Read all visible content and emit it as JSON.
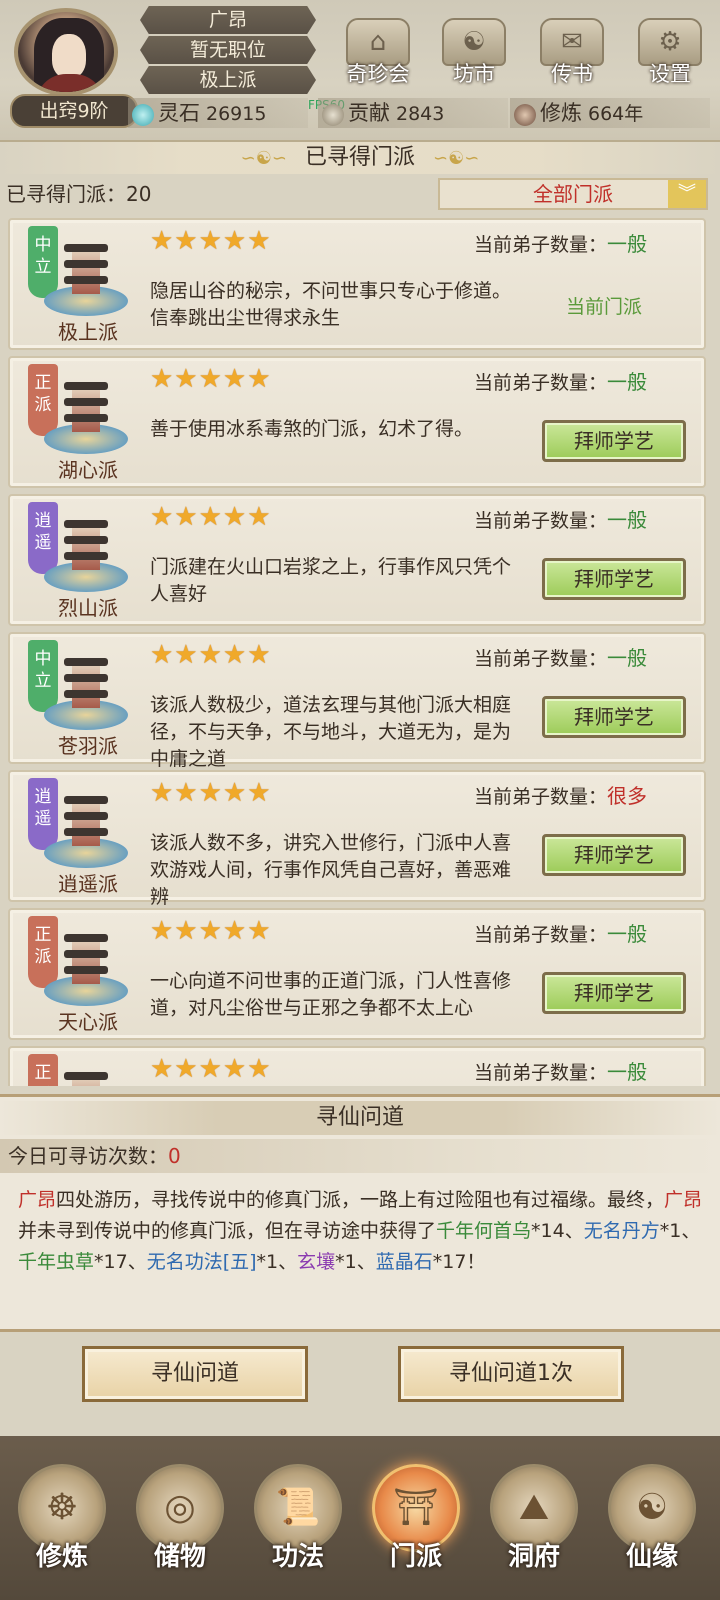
{
  "header": {
    "player_name": "广昂",
    "position": "暂无职位",
    "sect": "极上派",
    "realm": "出窍9阶",
    "resources": [
      {
        "label": "灵石",
        "value": "26915"
      },
      {
        "label": "贡献",
        "value": "2843"
      },
      {
        "label": "修炼",
        "value": "664年"
      }
    ],
    "menu": [
      {
        "label": "奇珍会",
        "icon": "treasure-pavilion-icon"
      },
      {
        "label": "坊市",
        "icon": "market-icon"
      },
      {
        "label": "传书",
        "icon": "scroll-letter-icon"
      },
      {
        "label": "设置",
        "icon": "gear-icon"
      }
    ],
    "fps": "FPS60"
  },
  "sect_list": {
    "title": "已寻得门派",
    "found_label": "已寻得门派：",
    "found_count": "20",
    "filter_value": "全部门派",
    "disciples_label": "当前弟子数量：",
    "items": [
      {
        "tag": [
          "中",
          "立"
        ],
        "tag_color": "#4fae6a",
        "name": "极上派",
        "stars": "★★★★★",
        "disciples": "一般",
        "disciples_color": "#3a8a3a",
        "desc": "隐居山谷的秘宗，不问世事只专心于修道。信奉跳出尘世得求永生",
        "action": "当前门派",
        "is_current": true
      },
      {
        "tag": [
          "正",
          "派"
        ],
        "tag_color": "#c8705a",
        "name": "湖心派",
        "stars": "★★★★★",
        "disciples": "一般",
        "disciples_color": "#3a8a3a",
        "desc": "善于使用冰系毒煞的门派，幻术了得。",
        "action": "拜师学艺",
        "is_current": false
      },
      {
        "tag": [
          "逍",
          "遥"
        ],
        "tag_color": "#8a6ac8",
        "name": "烈山派",
        "stars": "★★★★★",
        "disciples": "一般",
        "disciples_color": "#3a8a3a",
        "desc": "门派建在火山口岩浆之上，行事作风只凭个人喜好",
        "action": "拜师学艺",
        "is_current": false
      },
      {
        "tag": [
          "中",
          "立"
        ],
        "tag_color": "#4fae6a",
        "name": "苍羽派",
        "stars": "★★★★★",
        "disciples": "一般",
        "disciples_color": "#3a8a3a",
        "desc": "该派人数极少，道法玄理与其他门派大相庭径，不与天争，不与地斗，大道无为，是为中庸之道",
        "action": "拜师学艺",
        "is_current": false
      },
      {
        "tag": [
          "逍",
          "遥"
        ],
        "tag_color": "#8a6ac8",
        "name": "逍遥派",
        "stars": "★★★★★",
        "disciples": "很多",
        "disciples_color": "#c0302a",
        "desc": "该派人数不多，讲究入世修行，门派中人喜欢游戏人间，行事作风凭自己喜好，善恶难辨",
        "action": "拜师学艺",
        "is_current": false
      },
      {
        "tag": [
          "正",
          "派"
        ],
        "tag_color": "#c8705a",
        "name": "天心派",
        "stars": "★★★★★",
        "disciples": "一般",
        "disciples_color": "#3a8a3a",
        "desc": "一心向道不问世事的正道门派，门人性喜修道，对凡尘俗世与正邪之争都不太上心",
        "action": "拜师学艺",
        "is_current": false
      },
      {
        "tag": [
          "正",
          "派"
        ],
        "tag_color": "#c8705a",
        "name": "",
        "stars": "★★★★★",
        "disciples": "一般",
        "disciples_color": "#3a8a3a",
        "desc": "",
        "action": "",
        "is_current": false
      }
    ]
  },
  "seek": {
    "title": "寻仙问道",
    "today_label": "今日可寻访次数：",
    "today_count": "0",
    "story": {
      "name1": "广昂",
      "t1": "四处游历，寻找传说中的修真门派，一路上有过险阻也有过福缘。最终，",
      "name2": "广昂",
      "t2": "并未寻到传说中的修真门派，但在寻访途中获得了",
      "item1": "千年何首乌",
      "q1": "*14、",
      "item2": "无名丹方",
      "q2": "*1、",
      "item3": "千年虫草",
      "q3": "*17、",
      "item4": "无名功法[五]",
      "q4": "*1、",
      "item5": "玄壤",
      "q5": "*1、",
      "item6": "蓝晶石",
      "q6": "*17！"
    },
    "btn1": "寻仙问道",
    "btn2": "寻仙问道1次"
  },
  "bottom_nav": [
    {
      "label": "修炼",
      "icon": "meditation-icon",
      "active": false
    },
    {
      "label": "储物",
      "icon": "storage-bag-icon",
      "active": false
    },
    {
      "label": "功法",
      "icon": "technique-scroll-icon",
      "active": false
    },
    {
      "label": "门派",
      "icon": "sect-gate-icon",
      "active": true
    },
    {
      "label": "洞府",
      "icon": "cave-dwelling-icon",
      "active": false
    },
    {
      "label": "仙缘",
      "icon": "immortal-fate-icon",
      "active": false
    }
  ]
}
